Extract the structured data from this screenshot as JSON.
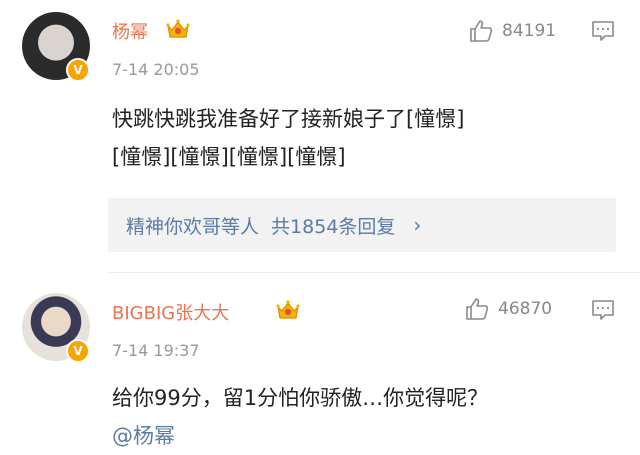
{
  "comments": [
    {
      "username": "杨幂",
      "time": "7-14 20:05",
      "likes": "84191",
      "text_line1": "快跳快跳我准备好了接新娘子了[憧憬]",
      "text_line2": "[憧憬][憧憬][憧憬][憧憬]",
      "replies": {
        "who": "精神你欢哥等人",
        "count": "共1854条回复"
      },
      "verified_badge": "V"
    },
    {
      "username": "BIGBIG张大大",
      "time": "7-14 19:37",
      "likes": "46870",
      "text_line1": "给你99分，留1分怕你骄傲…你觉得呢？",
      "mention": "@杨幂",
      "verified_badge": "V"
    }
  ],
  "colors": {
    "username": "#eb7350",
    "link": "#5b7ba6",
    "meta": "#999999",
    "badge": "#f7a400"
  },
  "icons": [
    "thumbs-up-icon",
    "comment-reply-icon",
    "crown-icon",
    "verified-v-icon",
    "chevron-right-icon"
  ]
}
